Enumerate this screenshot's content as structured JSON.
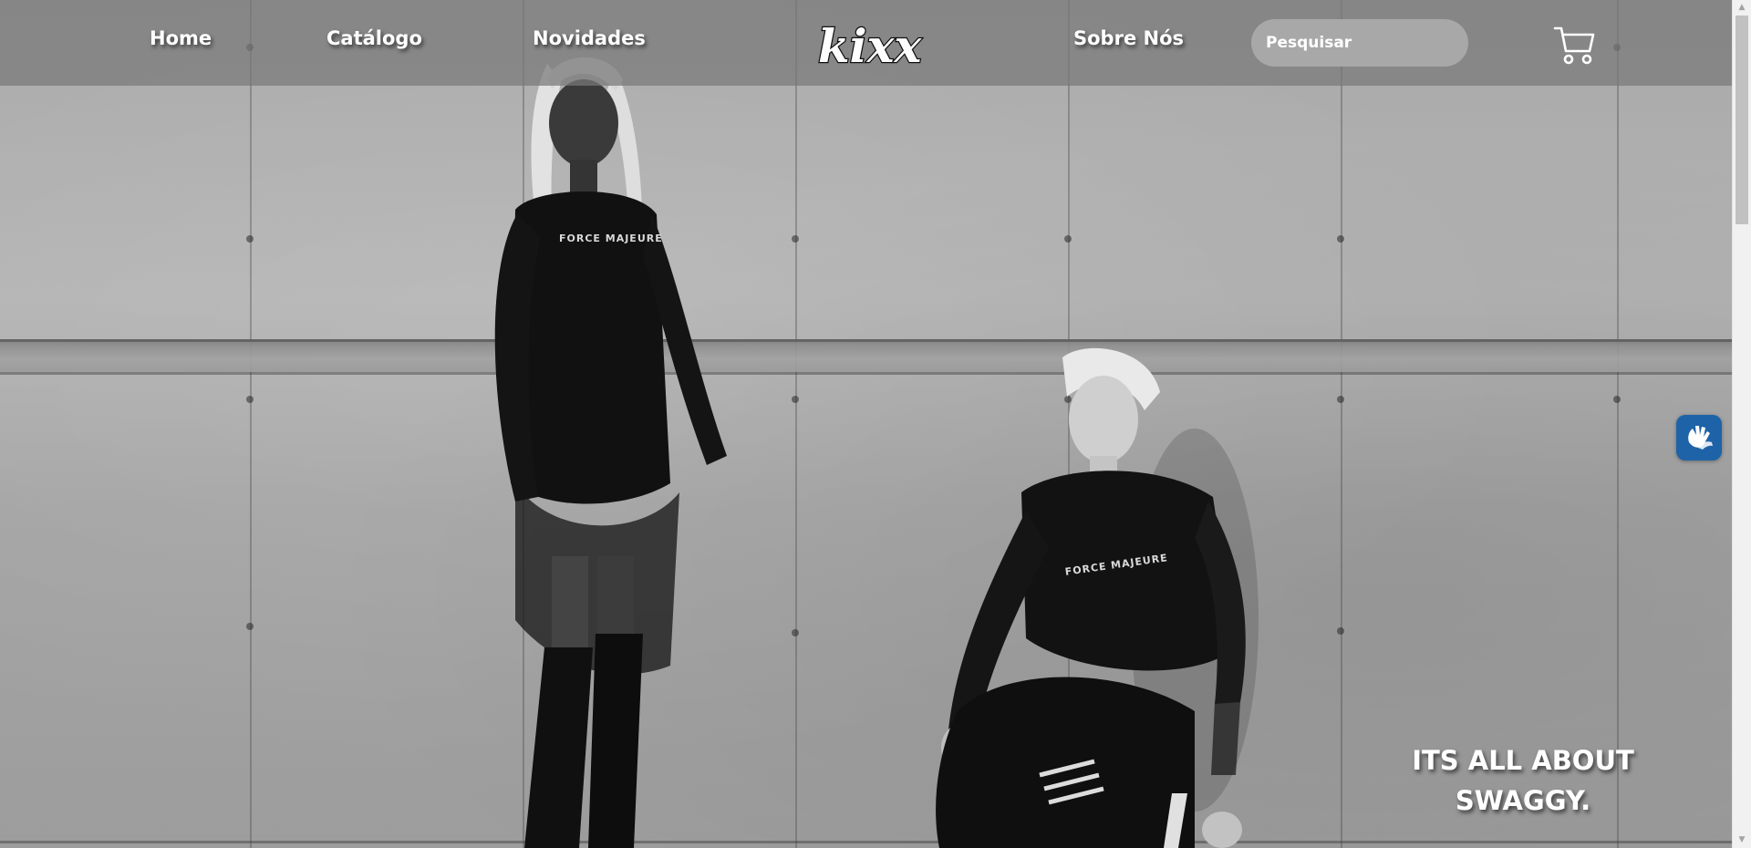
{
  "nav": {
    "links": [
      {
        "label": "Home"
      },
      {
        "label": "Catálogo"
      },
      {
        "label": "Novidades"
      },
      {
        "label": "Sobre Nós"
      }
    ],
    "logo_text": "kixx",
    "search_placeholder": "Pesquisar",
    "cart_icon": "shopping-cart-icon"
  },
  "hero": {
    "image_description_icon": "hero-photo",
    "shirt_print": "FORCE MAJEURE",
    "tagline_line1": "ITS ALL ABOUT",
    "tagline_line2": "SWAGGY."
  },
  "accessibility": {
    "icon": "sign-language-hands-icon",
    "accent_color": "#1e63a8"
  },
  "scrollbar": {
    "up_icon": "▲",
    "down_icon": "▼"
  }
}
